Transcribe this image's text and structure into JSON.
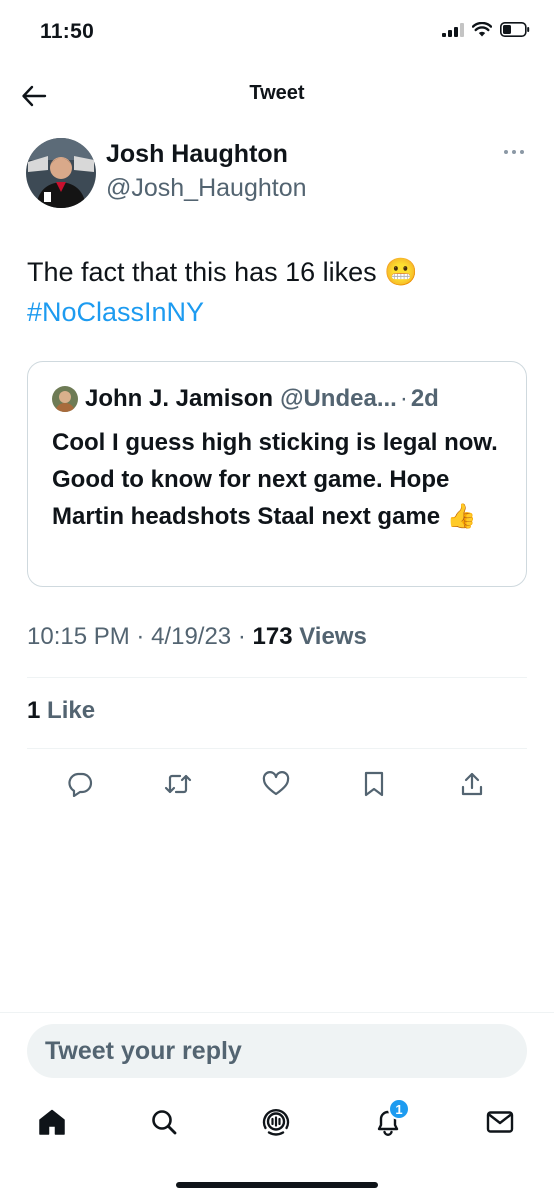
{
  "status_bar": {
    "time": "11:50"
  },
  "nav": {
    "title": "Tweet"
  },
  "tweet": {
    "author_name": "Josh Haughton",
    "author_handle": "@Josh_Haughton",
    "text": "The fact that this has 16 likes 😬",
    "hashtag": "#NoClassInNY",
    "quoted": {
      "author_name": "John J. Jamison",
      "author_handle": "@Undea...",
      "separator": "·",
      "time": "2d",
      "text": "Cool I guess high sticking is legal now. Good to know for next game. Hope Martin headshots Staal next game 👍"
    },
    "meta": {
      "time": "10:15 PM",
      "separator": "·",
      "date": "4/19/23",
      "views_count": "173",
      "views_label": "Views"
    },
    "likes": {
      "count": "1",
      "label": "Like"
    }
  },
  "actions": [
    {
      "icon": "reply-icon"
    },
    {
      "icon": "retweet-icon"
    },
    {
      "icon": "like-icon"
    },
    {
      "icon": "bookmark-icon"
    },
    {
      "icon": "share-icon"
    }
  ],
  "reply": {
    "placeholder": "Tweet your reply"
  },
  "tabbar": {
    "tabs": [
      {
        "icon": "home-icon"
      },
      {
        "icon": "search-icon"
      },
      {
        "icon": "spaces-icon"
      },
      {
        "icon": "notifications-icon",
        "badge": "1"
      },
      {
        "icon": "messages-icon"
      }
    ]
  },
  "colors": {
    "accent": "#1d9bf0",
    "text_primary": "#0f1419",
    "text_secondary": "#536471",
    "border": "#cfd9de"
  }
}
